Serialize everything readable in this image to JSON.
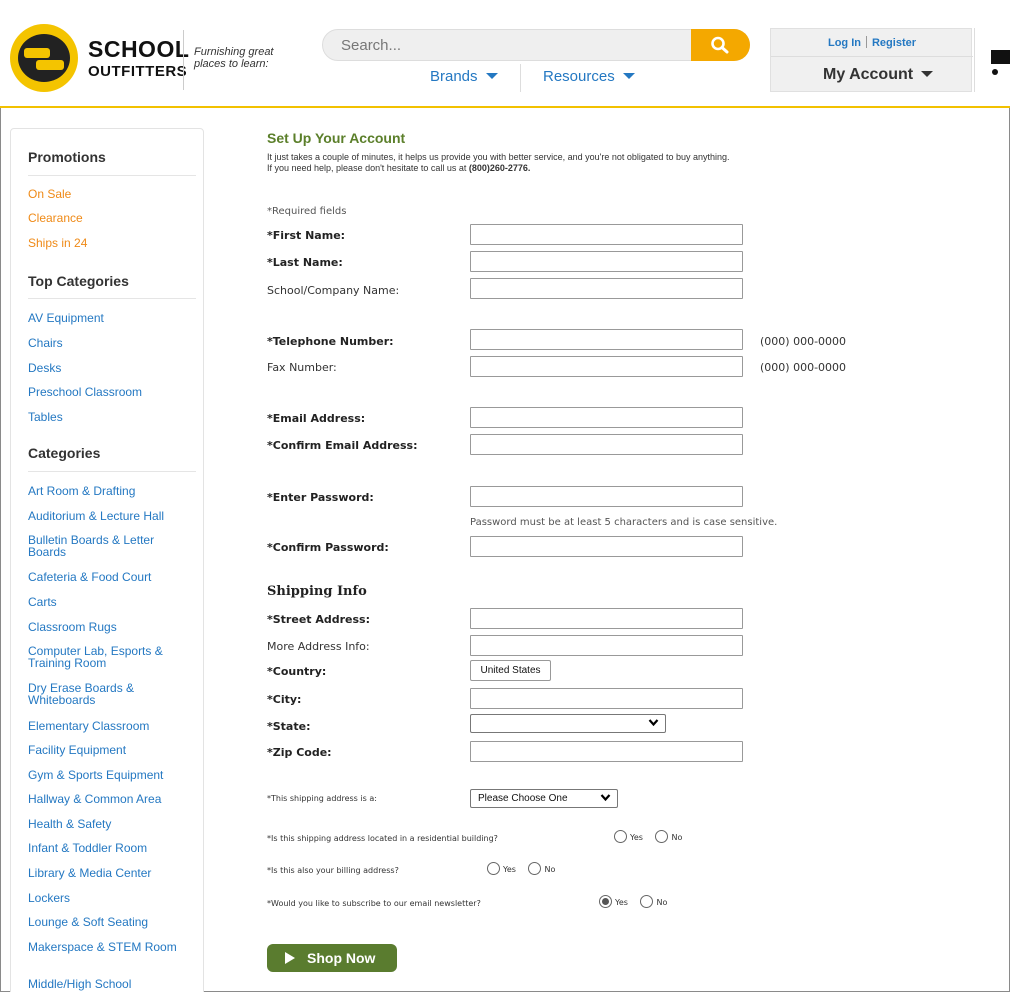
{
  "header": {
    "logo_line1": "SCHOOL",
    "logo_line2": "OUTFITTERS",
    "tagline": "Furnishing great places to learn:",
    "search_placeholder": "Search...",
    "nav": {
      "brands": "Brands",
      "resources": "Resources"
    },
    "account": {
      "login": "Log In",
      "register": "Register",
      "my_account": "My Account"
    },
    "accent_color": "#f4c400",
    "search_button_color": "#f4a800",
    "link_color": "#2478c2"
  },
  "sidebar": {
    "promotions_heading": "Promotions",
    "promotions": [
      "On Sale",
      "Clearance",
      "Ships in 24"
    ],
    "top_categories_heading": "Top Categories",
    "top_categories": [
      "AV Equipment",
      "Chairs",
      "Desks",
      "Preschool Classroom",
      "Tables"
    ],
    "categories_heading": "Categories",
    "categories": [
      "Art Room & Drafting",
      "Auditorium & Lecture Hall",
      "Bulletin Boards & Letter Boards",
      "Cafeteria & Food Court",
      "Carts",
      "Classroom Rugs",
      "Computer Lab, Esports & Training Room",
      "Dry Erase Boards & Whiteboards",
      "Elementary Classroom",
      "Facility Equipment",
      "Gym & Sports Equipment",
      "Hallway & Common Area",
      "Health & Safety",
      "Infant & Toddler Room",
      "Library & Media Center",
      "Lockers",
      "Lounge & Soft Seating",
      "Makerspace & STEM Room",
      "Middle/High School"
    ]
  },
  "main": {
    "title": "Set Up Your Account",
    "intro_line1": "It just takes a couple of minutes, it helps us provide you with better service, and you're not obligated to buy anything.",
    "intro_line2_prefix": "If you need help, please don't hesitate to call us at ",
    "phone": "(800)260-2776.",
    "required_note": "*Required fields",
    "labels": {
      "first_name": "*First Name:",
      "last_name": "*Last Name:",
      "school": "School/Company Name:",
      "telephone": "*Telephone Number:",
      "fax": "Fax Number:",
      "email": "*Email Address:",
      "confirm_email": "*Confirm Email Address:",
      "password": "*Enter Password:",
      "confirm_password": "*Confirm Password:",
      "street": "*Street Address:",
      "more_address": "More Address Info:",
      "country": "*Country:",
      "city": "*City:",
      "state": "*State:",
      "zip": "*Zip Code:"
    },
    "phone_format": "(000) 000-0000",
    "fax_format": "(000) 000-0000",
    "password_hint": "Password must be at least 5 characters and is case sensitive.",
    "shipping_heading": "Shipping Info",
    "country_value": "United States",
    "state_value": "",
    "address_type_label": "*This shipping address is a:",
    "address_type_value": "Please Choose One",
    "q_residential": "*Is this shipping address located in a residential building?",
    "q_billing": "*Is this also your billing address?",
    "q_newsletter": "*Would you like to subscribe to our email newsletter?",
    "yes": "Yes",
    "no": "No",
    "newsletter_selected": "Yes",
    "submit_label": "Shop Now",
    "title_color": "#5b7f2a",
    "button_color": "#5a7c2f"
  }
}
